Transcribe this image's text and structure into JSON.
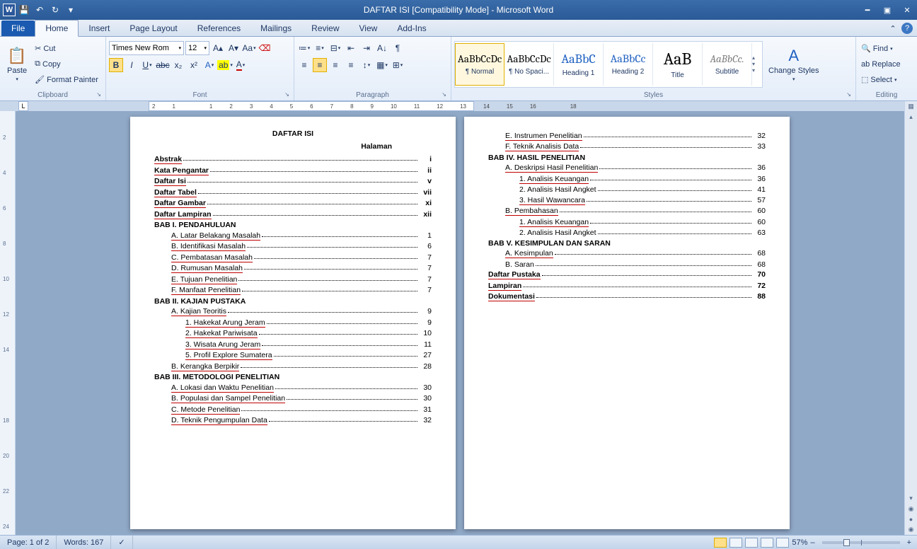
{
  "title": "DAFTAR ISI [Compatibility Mode] - Microsoft Word",
  "tabs": {
    "file": "File",
    "home": "Home",
    "insert": "Insert",
    "pagelayout": "Page Layout",
    "references": "References",
    "mailings": "Mailings",
    "review": "Review",
    "view": "View",
    "addins": "Add-Ins"
  },
  "clipboard": {
    "paste": "Paste",
    "cut": "Cut",
    "copy": "Copy",
    "fmt": "Format Painter",
    "label": "Clipboard"
  },
  "font": {
    "name": "Times New Rom",
    "size": "12",
    "label": "Font"
  },
  "paragraph": {
    "label": "Paragraph"
  },
  "styles": {
    "label": "Styles",
    "normal": "¶ Normal",
    "nospace": "¶ No Spaci...",
    "h1": "Heading 1",
    "h2": "Heading 2",
    "title": "Title",
    "subtitle": "Subtitle",
    "change": "Change Styles"
  },
  "editing": {
    "find": "Find",
    "replace": "Replace",
    "select": "Select",
    "label": "Editing"
  },
  "ruler": [
    "2",
    "1",
    "",
    "1",
    "2",
    "3",
    "4",
    "5",
    "6",
    "7",
    "8",
    "9",
    "10",
    "11",
    "12",
    "13",
    "14",
    "15",
    "16",
    "",
    "18"
  ],
  "vruler": [
    "",
    "2",
    "",
    "4",
    "",
    "6",
    "",
    "8",
    "",
    "10",
    "",
    "12",
    "",
    "14",
    "",
    "",
    "",
    "18",
    "",
    "20",
    "",
    "22",
    "",
    "24"
  ],
  "status": {
    "page": "Page: 1 of 2",
    "words": "Words: 167",
    "zoom": "57%"
  },
  "doc": {
    "title": "DAFTAR ISI",
    "halaman": "Halaman",
    "p1": [
      {
        "t": "Abstrak",
        "pg": "i",
        "b": 1,
        "i": 0,
        "sq": 1
      },
      {
        "t": "Kata Pengantar",
        "pg": "ii",
        "b": 1,
        "i": 0,
        "sq": 1
      },
      {
        "t": "Daftar Isi",
        "pg": "v",
        "b": 1,
        "i": 0,
        "sq": 1
      },
      {
        "t": "Daftar Tabel",
        "pg": "vii",
        "b": 1,
        "i": 0,
        "sq": 1
      },
      {
        "t": "Daftar Gambar",
        "pg": "xi",
        "b": 1,
        "i": 0,
        "sq": 1
      },
      {
        "t": "Daftar Lampiran",
        "pg": "xii",
        "b": 1,
        "i": 0,
        "sq": 1
      },
      {
        "t": "BAB I. PENDAHULUAN",
        "pg": "",
        "b": 1,
        "i": 0,
        "nd": 1
      },
      {
        "t": "A. Latar Belakang Masalah",
        "pg": "1",
        "i": 1,
        "sq": 1
      },
      {
        "t": "B. Identifikasi Masalah",
        "pg": "6",
        "i": 1,
        "sq": 1
      },
      {
        "t": "C. Pembatasan Masalah",
        "pg": "7",
        "i": 1,
        "sq": 1
      },
      {
        "t": "D. Rumusan Masalah",
        "pg": "7",
        "i": 1,
        "sq": 1
      },
      {
        "t": "E. Tujuan Penelitian",
        "pg": "7",
        "i": 1,
        "sq": 1
      },
      {
        "t": "F. Manfaat Penelitian",
        "pg": "7",
        "i": 1,
        "sq": 1
      },
      {
        "t": "BAB II. KAJIAN PUSTAKA",
        "pg": "",
        "b": 1,
        "i": 0,
        "nd": 1
      },
      {
        "t": "A. Kajian Teoritis",
        "pg": "9",
        "i": 1,
        "sq": 1
      },
      {
        "t": "1. Hakekat Arung Jeram",
        "pg": "9",
        "i": 2,
        "sq": 1
      },
      {
        "t": "2. Hakekat Pariwisata",
        "pg": "10",
        "i": 2,
        "sq": 1
      },
      {
        "t": "3. Wisata Arung Jeram",
        "pg": "11",
        "i": 2,
        "sq": 1
      },
      {
        "t": "5. Profil Explore Sumatera",
        "pg": "27",
        "i": 2,
        "sq": 1
      },
      {
        "t": "B. Kerangka Berpikir",
        "pg": "28",
        "i": 1,
        "sq": 1
      },
      {
        "t": "BAB III. METODOLOGI PENELITIAN",
        "pg": "",
        "b": 1,
        "i": 0,
        "nd": 1
      },
      {
        "t": "A. Lokasi dan Waktu Penelitian",
        "pg": "30",
        "i": 1,
        "sq": 1
      },
      {
        "t": "B. Populasi dan Sampel Penelitian",
        "pg": "30",
        "i": 1,
        "sq": 1
      },
      {
        "t": "C. Metode Penelitian",
        "pg": "31",
        "i": 1,
        "sq": 1
      },
      {
        "t": "D. Teknik Pengumpulan Data",
        "pg": "32",
        "i": 1,
        "sq": 1
      }
    ],
    "p2": [
      {
        "t": "E. Instrumen Penelitian",
        "pg": "32",
        "i": 1,
        "sq": 1
      },
      {
        "t": "F. Teknik Analisis Data",
        "pg": "33",
        "i": 1,
        "sq": 1
      },
      {
        "t": "BAB IV. HASIL PENELITIAN",
        "pg": "",
        "b": 1,
        "i": 0,
        "nd": 1
      },
      {
        "t": "A. Deskripsi Hasil Penelitian",
        "pg": "36",
        "i": 1,
        "sq": 1
      },
      {
        "t": "1. Analisis Keuangan",
        "pg": "36",
        "i": 2,
        "sq": 1
      },
      {
        "t": "2. Analisis Hasil Angket",
        "pg": "41",
        "i": 2
      },
      {
        "t": "3. Hasil Wawancara",
        "pg": "57",
        "i": 2,
        "sq": 1
      },
      {
        "t": "B. Pembahasan",
        "pg": "60",
        "i": 1,
        "sq": 1
      },
      {
        "t": "1. Analisis Keuangan",
        "pg": "60",
        "i": 2,
        "sq": 1
      },
      {
        "t": "2. Analisis Hasil Angket",
        "pg": "63",
        "i": 2
      },
      {
        "t": "BAB V. KESIMPULAN DAN SARAN",
        "pg": "",
        "b": 1,
        "i": 0,
        "nd": 1
      },
      {
        "t": "A. Kesimpulan",
        "pg": "68",
        "i": 1,
        "sq": 1
      },
      {
        "t": "B. Saran",
        "pg": "68",
        "i": 1
      },
      {
        "t": "Daftar Pustaka",
        "pg": "70",
        "b": 1,
        "i": 0,
        "sq": 1
      },
      {
        "t": "Lampiran",
        "pg": "72",
        "b": 1,
        "i": 0,
        "sq": 1
      },
      {
        "t": "Dokumentasi",
        "pg": "88",
        "b": 1,
        "i": 0,
        "sq": 1
      }
    ]
  }
}
